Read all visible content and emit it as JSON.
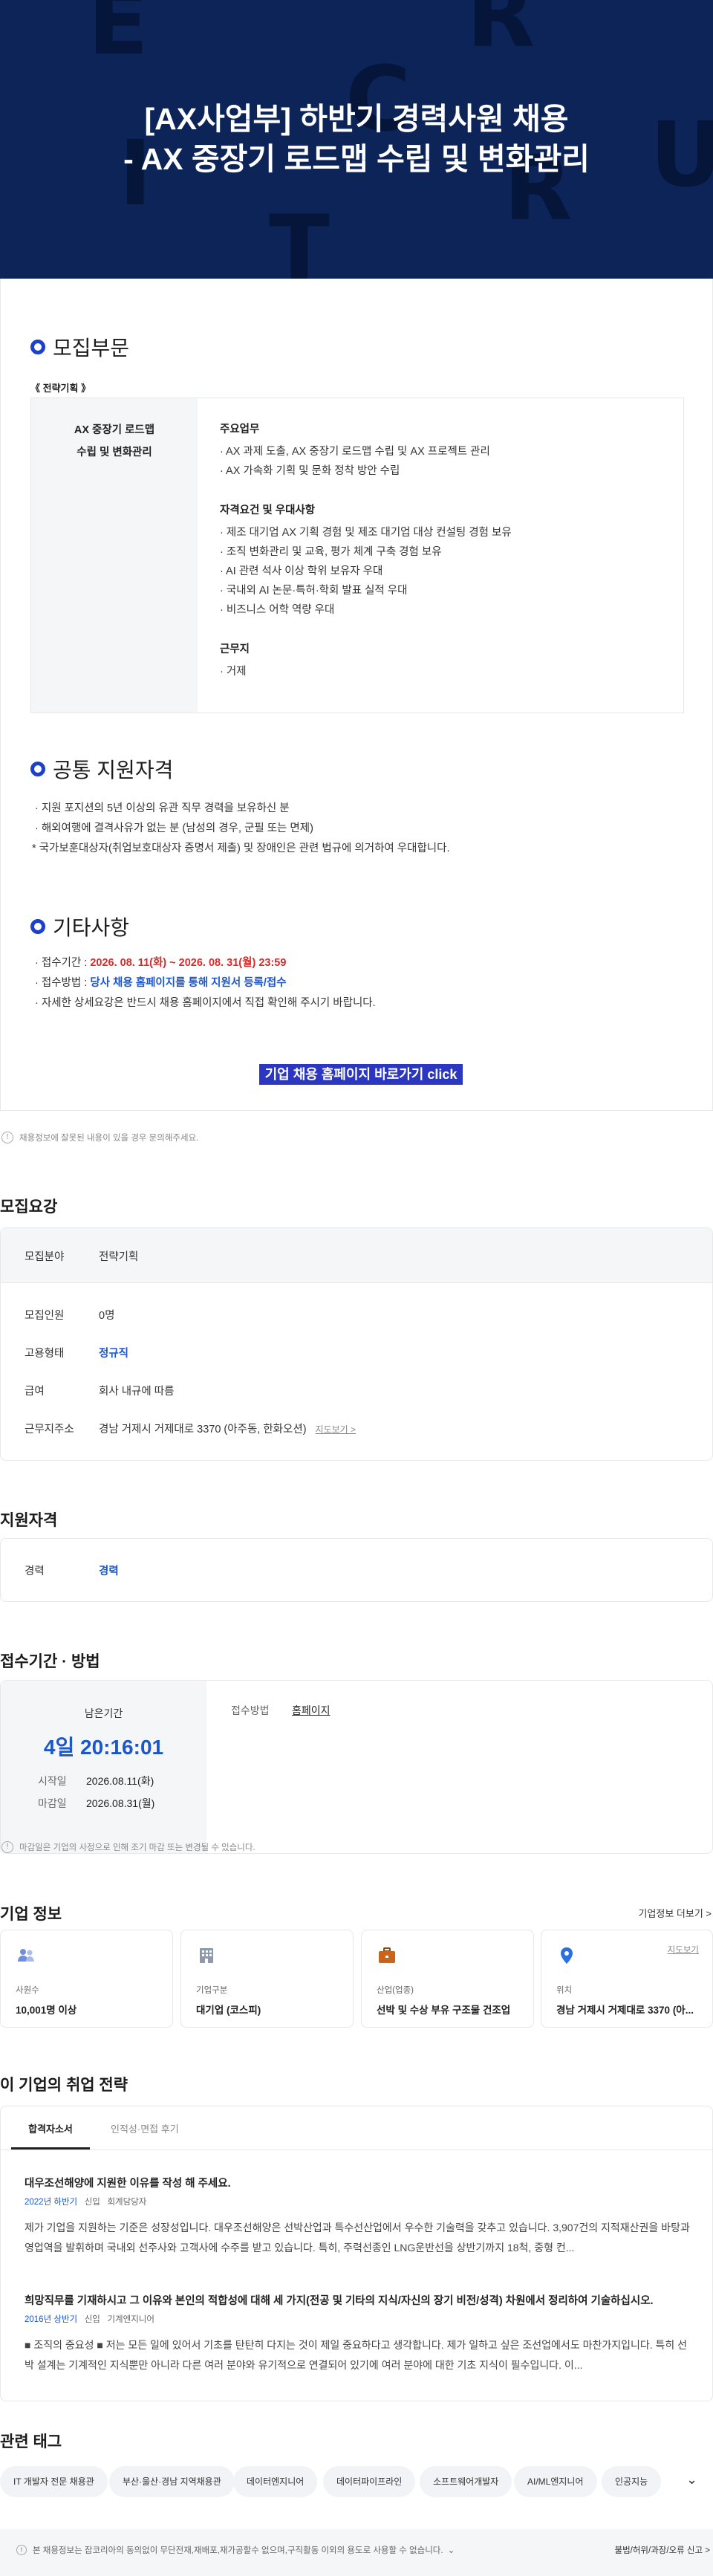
{
  "hero": {
    "title_line1": "[AX사업부] 하반기 경력사원 채용",
    "title_line2": "- AX 중장기 로드맵 수립 및 변화관리"
  },
  "poster": {
    "recruit_section_title": "모집부문",
    "team_tag": "《 전략기획 》",
    "job_name_line1": "AX 중장기 로드맵",
    "job_name_line2": "수립 및 변화관리",
    "duties_heading": "주요업무",
    "duties": [
      "· AX 과제 도출, AX 중장기 로드맵 수립 및 AX 프로젝트 관리",
      "· AX 가속화 기획 및 문화 정착 방안 수립"
    ],
    "qual_heading": "자격요건 및 우대사항",
    "quals": [
      "· 제조 대기업 AX 기획 경험 및 제조 대기업 대상 컨설팅 경험 보유",
      "· 조직 변화관리 및 교육, 평가 체계 구축 경험 보유",
      "· AI 관련 석사 이상 학위 보유자 우대",
      "· 국내외 AI 논문·특허·학회 발표 실적 우대",
      "· 비즈니스 어학 역량 우대"
    ],
    "location_heading": "근무지",
    "locations": [
      "· 거제"
    ],
    "common_title": "공통 지원자격",
    "common": [
      "· 지원 포지션의 5년 이상의 유관 직무 경력을 보유하신 분",
      "· 해외여행에 결격사유가 없는 분 (남성의 경우, 군필 또는 면제)",
      "* 국가보훈대상자(취업보호대상자 증명서 제출) 및 장애인은 관련 법규에 의거하여 우대합니다."
    ],
    "etc_title": "기타사항",
    "period_prefix": "· 접수기간 : ",
    "period_value": "2026. 08. 11(화) ~ 2026. 08. 31(월) 23:59",
    "method_prefix": "· 접수방법 : ",
    "method_value": "당사 채용 홈페이지를 통해 지원서 등록/접수",
    "detail_note": "· 자세한 상세요강은 반드시 채용 홈페이지에서 직접 확인해 주시기 바랍니다.",
    "cta": "기업 채용 홈페이지 바로가기 click"
  },
  "report_notice": "채용정보에 잘못된 내용이 있을 경우 문의해주세요.",
  "summary": {
    "title": "모집요강",
    "field_label": "모집분야",
    "field_value": "전략기획",
    "rows": [
      {
        "k": "모집인원",
        "v": "0명"
      },
      {
        "k": "고용형태",
        "v": "정규직"
      },
      {
        "k": "급여",
        "v": "회사 내규에 따름"
      },
      {
        "k": "근무지주소",
        "v": "경남 거제시 거제대로 3370 (아주동, 한화오션)"
      }
    ],
    "map_link": "지도보기 >"
  },
  "qualification": {
    "title": "지원자격",
    "k": "경력",
    "v": "경력"
  },
  "apply": {
    "title": "접수기간 · 방법",
    "remain_label": "남은기간",
    "remain_value": "4일 20:16:01",
    "start_label": "시작일",
    "start_value": "2026.08.11(화)",
    "end_label": "마감일",
    "end_value": "2026.08.31(월)",
    "method_label": "접수방법",
    "method_value": "홈페이지",
    "deadline_note": "마감일은 기업의 사정으로 인해 조기 마감 또는 변경될 수 있습니다."
  },
  "company": {
    "title": "기업 정보",
    "more": "기업정보 더보기 >",
    "cards": [
      {
        "icon": "people-icon",
        "label": "사원수",
        "value": "10,001명 이상"
      },
      {
        "icon": "building-icon",
        "label": "기업구분",
        "value": "대기업 (코스피)"
      },
      {
        "icon": "briefcase-icon",
        "label": "산업(업종)",
        "value": "선박 및 수상 부유 구조물 건조업"
      },
      {
        "icon": "location-pin-icon",
        "label": "위치",
        "value": "경남 거제시 거제대로 3370 (아...",
        "link": "지도보기"
      }
    ]
  },
  "strategy": {
    "title": "이 기업의 취업 전략",
    "tabs": [
      "합격자소서",
      "인적성·면접 후기"
    ],
    "items": [
      {
        "q": "대우조선해양에 지원한 이유를 작성 해 주세요.",
        "meta_year": "2022년 하반기",
        "meta_type": "신입",
        "meta_job": "회계담당자",
        "body": "제가 기업을 지원하는 기준은 성장성입니다. 대우조선해양은 선박산업과 특수선산업에서 우수한 기술력을 갖추고 있습니다. 3,907건의 지적재산권을 바탕과 영업역을 발휘하며 국내외 선주사와 고객사에 수주를 받고 있습니다. 특히, 주력선종인 LNG운반선을 상반기까지 18척, 중형 컨..."
      },
      {
        "q": "희망직무를 기재하시고 그 이유와 본인의 적합성에 대해 세 가지(전공 및 기타의 지식/자신의 장기 비전/성격) 차원에서 정리하여 기술하십시오.",
        "meta_year": "2016년 상반기",
        "meta_type": "신입",
        "meta_job": "기계엔지니어",
        "body": "■ 조직의 중요성 ■ 저는 모든 일에 있어서 기초를 탄탄히 다지는 것이 제일 중요하다고 생각합니다. 제가 일하고 싶은 조선업에서도 마찬가지입니다. 특히 선박 설계는 기계적인 지식뿐만 아니라 다른 여러 분야와 유기적으로 연결되어 있기에 여러 분야에 대한 기초 지식이 필수입니다. 이..."
      }
    ]
  },
  "tags": {
    "title": "관련 태그",
    "items": [
      "IT 개발자 전문 채용관",
      "부산·울산·경남 지역채용관",
      "데이터엔지니어",
      "데이터파이프라인",
      "소프트웨어개발자",
      "AI/ML엔지니어",
      "인공지능"
    ]
  },
  "footer": {
    "notice": "본 채용정보는 잡코리아의 동의없이 무단전재,재배포,재가공할수 없으며,구직활동 이외의 용도로 사용할 수 없습니다.",
    "report": "불법/허위/과장/오류 신고 >"
  }
}
